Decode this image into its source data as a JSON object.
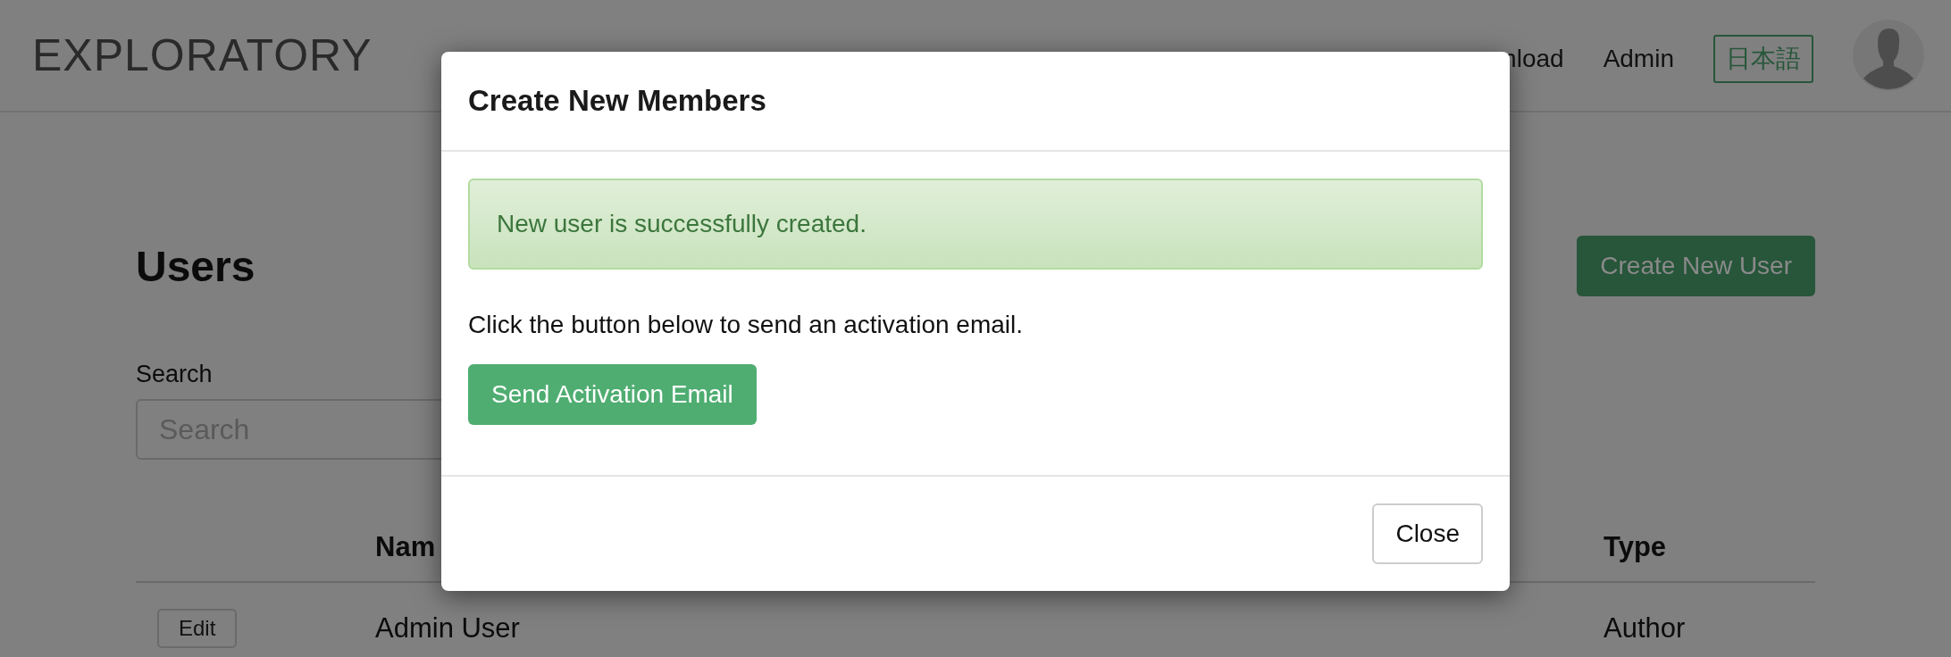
{
  "header": {
    "logo": "EXPLORATORY",
    "nav": [
      {
        "label": "nload"
      },
      {
        "label": "Admin"
      }
    ],
    "language": "日本語"
  },
  "page": {
    "title": "Users",
    "create_button": "Create New User",
    "search": {
      "label": "Search",
      "placeholder": "Search"
    },
    "table": {
      "columns": [
        "Nam",
        "Type"
      ],
      "rows": [
        {
          "action": "Edit",
          "name": "Admin User",
          "type": "Author"
        }
      ]
    }
  },
  "modal": {
    "title": "Create New Members",
    "alert": "New user is successfully created.",
    "message": "Click the button below to send an activation email.",
    "primary_button": "Send Activation Email",
    "close_button": "Close"
  }
}
